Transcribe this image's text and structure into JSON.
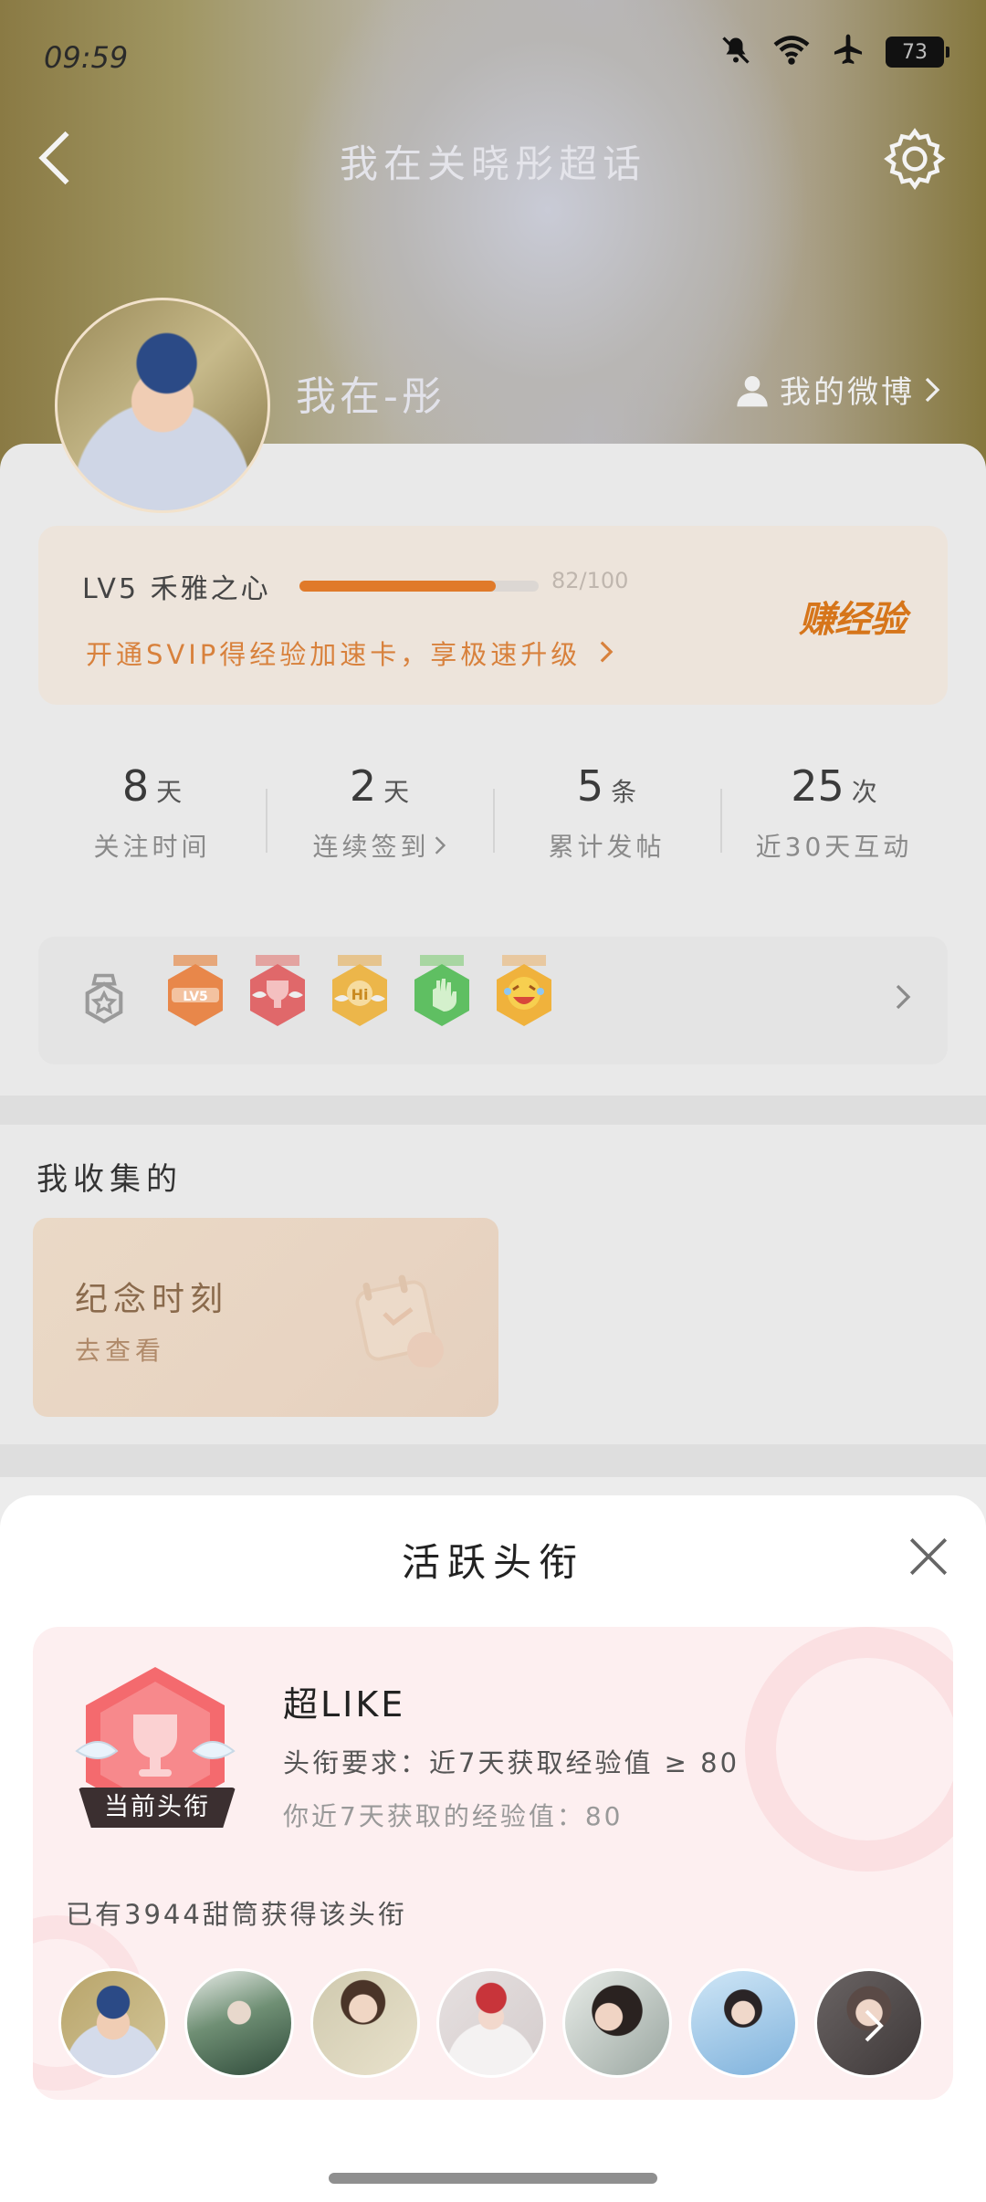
{
  "status_bar": {
    "time": "09:59",
    "battery": "73"
  },
  "header": {
    "title": "我在关晓彤超话"
  },
  "profile": {
    "username": "我在-彤",
    "weibo_link": "我的微博"
  },
  "level": {
    "label": "LV5 禾雅之心",
    "progress_text": "82/100",
    "progress_fraction": 0.82,
    "svip_promo": "开通SVIP得经验加速卡，享极速升级",
    "earn_button": "赚经验",
    "accent_color": "#e07a2a"
  },
  "stats": [
    {
      "value": "8",
      "unit": "天",
      "label": "关注时间"
    },
    {
      "value": "2",
      "unit": "天",
      "label": "连续签到"
    },
    {
      "value": "5",
      "unit": "条",
      "label": "累计发帖"
    },
    {
      "value": "25",
      "unit": "次",
      "label": "近30天互动"
    }
  ],
  "badges": {
    "icons": [
      "lv5-badge-icon",
      "trophy-badge-icon",
      "hi-badge-icon",
      "hand-badge-icon",
      "laugh-badge-icon"
    ]
  },
  "collections": {
    "title": "我收集的",
    "memory_card": {
      "title": "纪念时刻",
      "subtitle": "去查看"
    }
  },
  "sheet": {
    "title": "活跃头衔",
    "current_tag": "当前头衔",
    "title_name": "超LIKE",
    "requirement": "头衔要求：近7天获取经验值 ≥ 80",
    "my_exp": "你近7天获取的经验值：80",
    "holders_count": "已有3944甜筒获得该头衔",
    "holder_count_shown": 7
  }
}
